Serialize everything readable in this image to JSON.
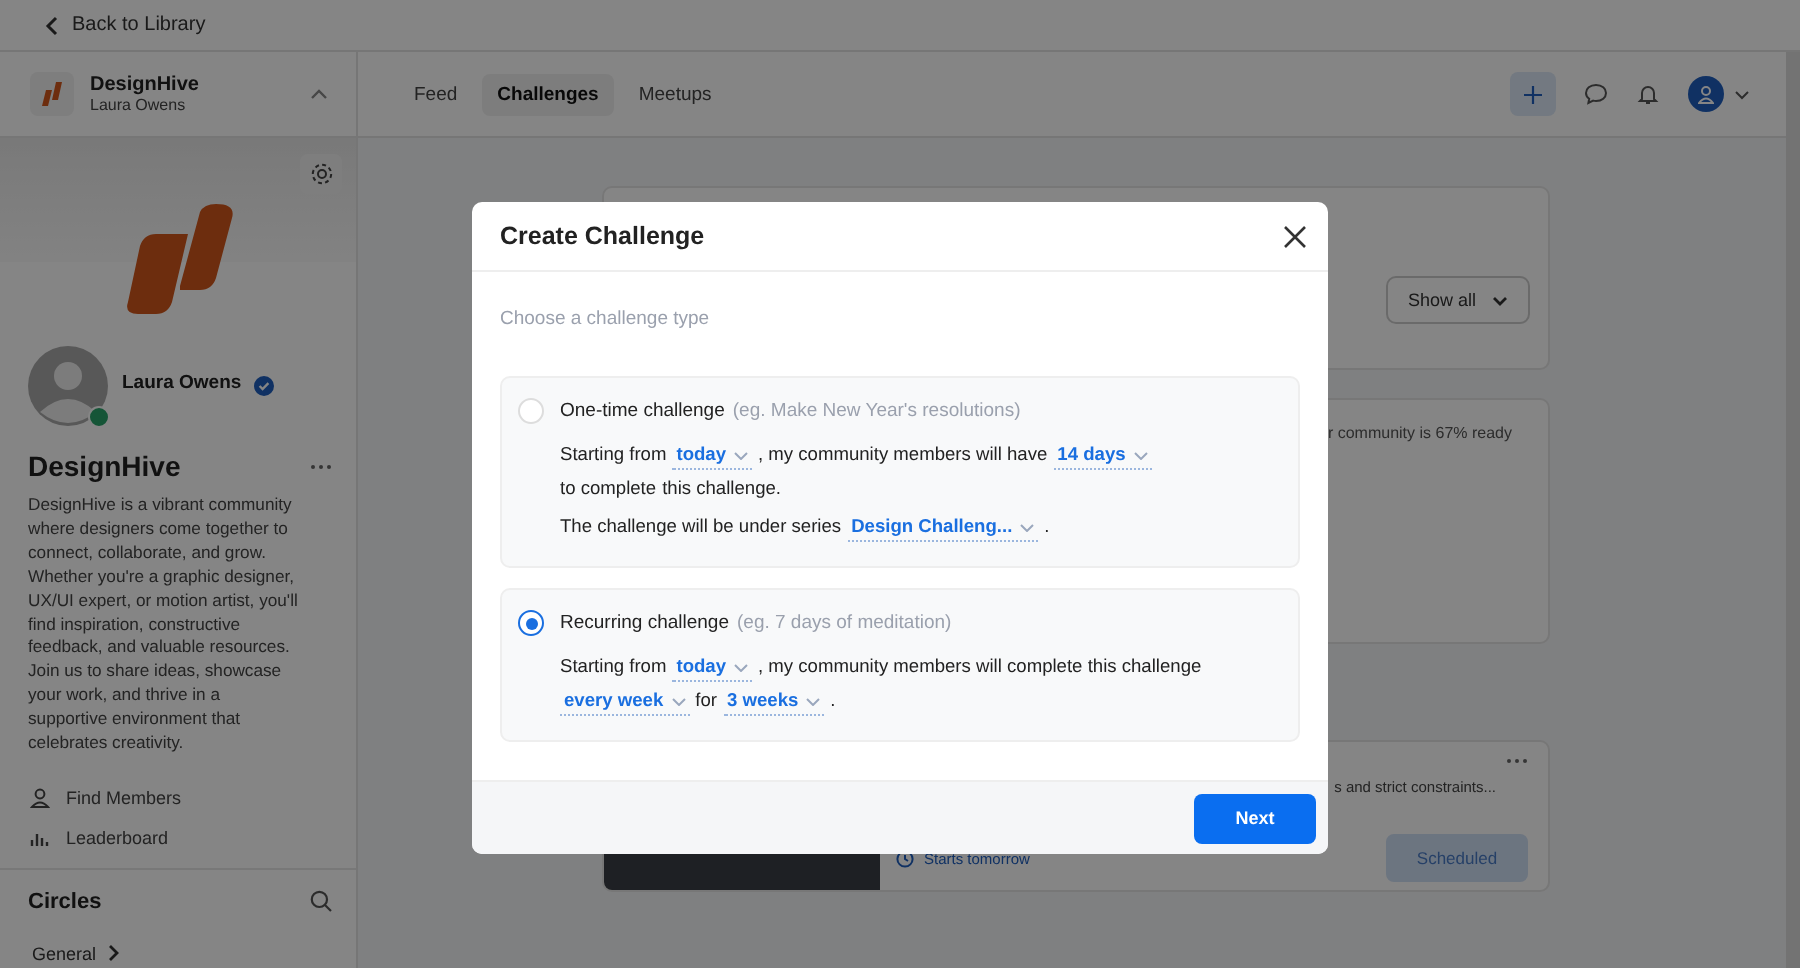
{
  "top_bar": {
    "back_link": "Back to Library"
  },
  "community_switcher": {
    "name": "DesignHive",
    "user": "Laura Owens"
  },
  "sidebar": {
    "profile_name": "Laura Owens",
    "community_name": "DesignHive",
    "description": "DesignHive is a vibrant community where designers come together to connect, collaborate, and grow. Whether you're a graphic designer, UX/UI expert, or motion artist, you'll find inspiration, constructive feedback, and valuable resources. Join us to share ideas, showcase your work, and thrive in a supportive environment that celebrates creativity.",
    "links": [
      {
        "label": "Find Members",
        "kind": "members"
      },
      {
        "label": "Leaderboard",
        "kind": "leaderboard"
      }
    ],
    "circles_title": "Circles",
    "circles": [
      {
        "label": "General"
      }
    ]
  },
  "nav": {
    "tabs": [
      {
        "label": "Feed",
        "selected": false
      },
      {
        "label": "Challenges",
        "selected": true
      },
      {
        "label": "Meetups",
        "selected": false
      }
    ]
  },
  "background": {
    "filter_button": "Show all",
    "progress_text": "r community is 67% ready",
    "challenge_snippet": "s and strict constraints...",
    "start_note": "Starts tomorrow",
    "status_badge": "Scheduled"
  },
  "modal": {
    "title": "Create Challenge",
    "subtitle": "Choose a challenge type",
    "options": [
      {
        "title": "One-time challenge",
        "hint": "(eg. Make New Year's resolutions)",
        "selected": false,
        "lines": [
          [
            {
              "kind": "text",
              "text": "Starting from"
            },
            {
              "kind": "select",
              "value": "today"
            },
            {
              "kind": "text",
              "text": ", my community members will have"
            },
            {
              "kind": "select",
              "value": "14 days"
            },
            {
              "kind": "text",
              "text": "to complete"
            },
            {
              "kind": "text",
              "text": "this challenge."
            }
          ],
          [
            {
              "kind": "text",
              "text": "The challenge will be under series"
            },
            {
              "kind": "select",
              "value": "Design Challeng..."
            },
            {
              "kind": "text",
              "text": "."
            }
          ]
        ]
      },
      {
        "title": "Recurring challenge",
        "hint": "(eg. 7 days of meditation)",
        "selected": true,
        "lines": [
          [
            {
              "kind": "text",
              "text": "Starting from"
            },
            {
              "kind": "select",
              "value": "today"
            },
            {
              "kind": "text",
              "text": ", my community members will complete this challenge"
            },
            {
              "kind": "select",
              "value": "every week"
            },
            {
              "kind": "text",
              "text": "for"
            },
            {
              "kind": "select",
              "value": "3 weeks"
            },
            {
              "kind": "text",
              "text": "."
            }
          ]
        ]
      }
    ],
    "next_button": "Next"
  }
}
